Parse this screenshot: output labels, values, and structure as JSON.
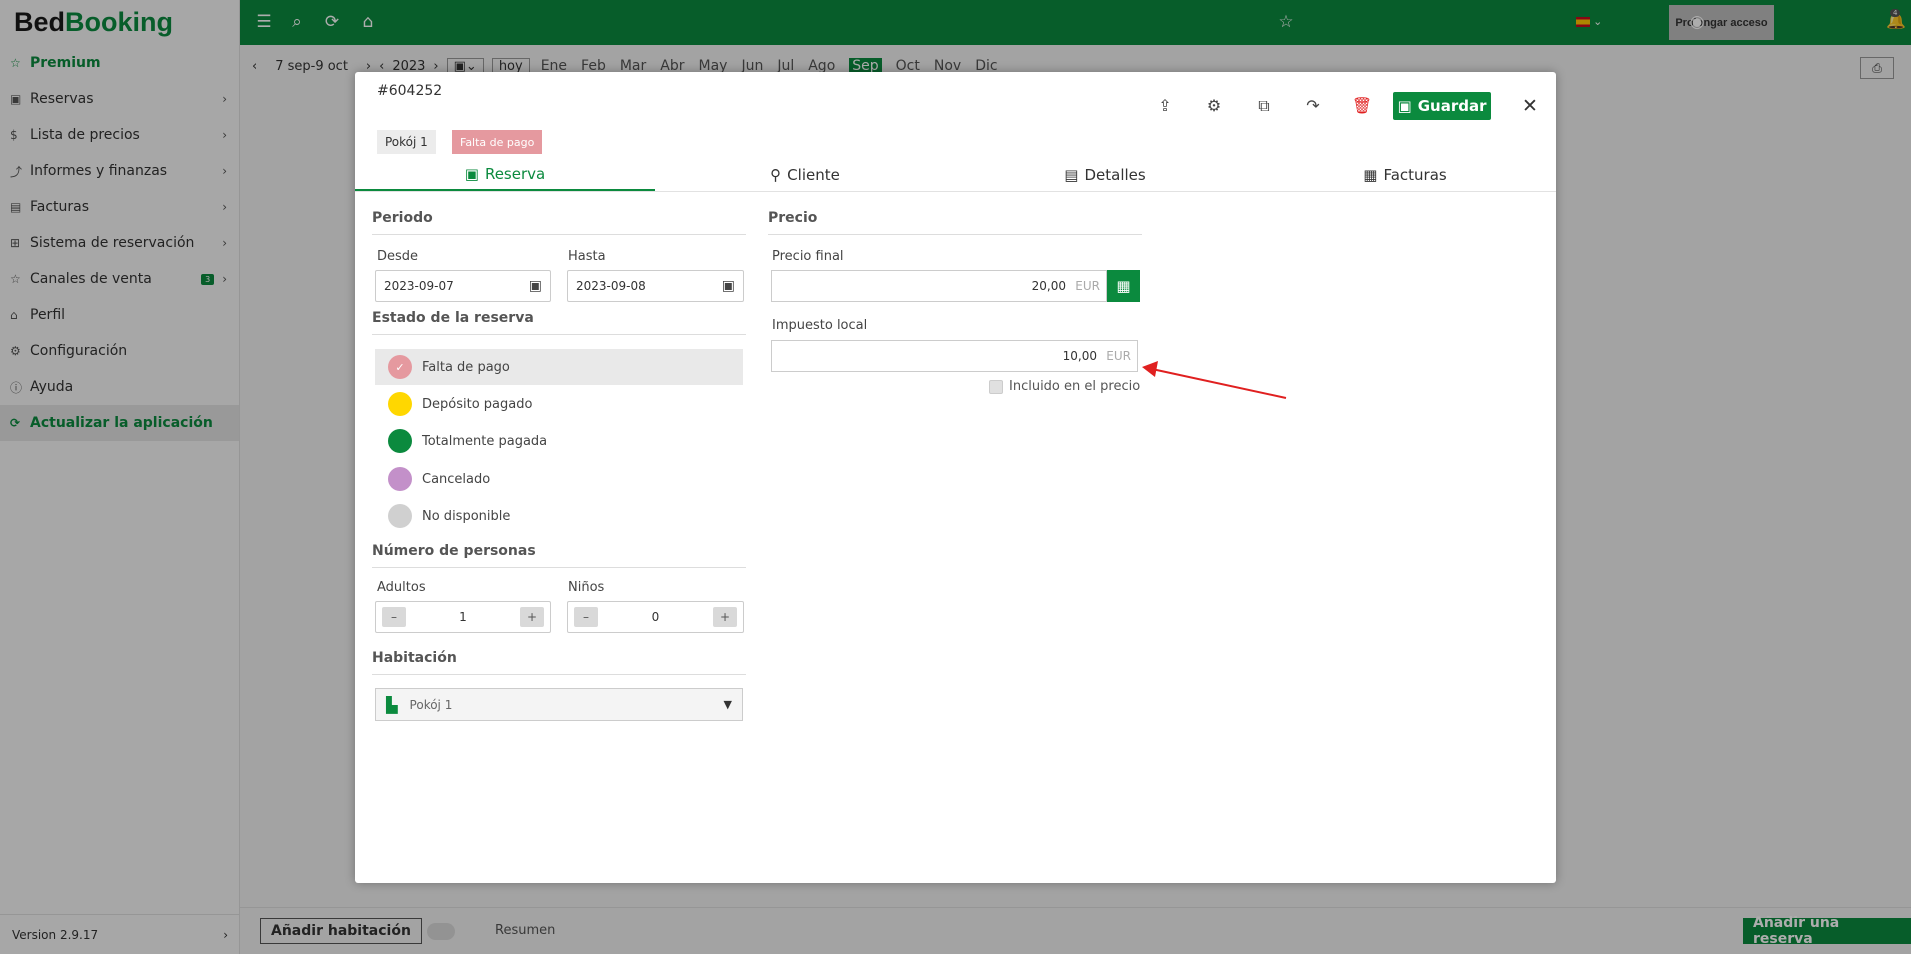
{
  "app": {
    "logo_a": "Bed",
    "logo_b": "Booking"
  },
  "sidebar": {
    "items": [
      {
        "label": "Premium",
        "icon": "star-icon"
      },
      {
        "label": "Reservas",
        "icon": "calendar-icon"
      },
      {
        "label": "Lista de precios",
        "icon": "dollar-icon"
      },
      {
        "label": "Informes y finanzas",
        "icon": "chart-icon"
      },
      {
        "label": "Facturas",
        "icon": "invoice-icon"
      },
      {
        "label": "Sistema de reservación",
        "icon": "grid-icon"
      },
      {
        "label": "Canales de venta",
        "icon": "star-outline-icon",
        "badge": "3"
      },
      {
        "label": "Perfil",
        "icon": "building-icon"
      },
      {
        "label": "Configuración",
        "icon": "gear-icon"
      },
      {
        "label": "Ayuda",
        "icon": "info-icon"
      },
      {
        "label": "Actualizar la aplicación",
        "icon": "refresh-icon"
      }
    ],
    "version": "Version 2.9.17"
  },
  "topbar": {
    "prolong": "Prolongar acceso",
    "notifications": "4"
  },
  "calendar": {
    "range": "7 sep-9 oct",
    "year": "2023",
    "today": "hoy",
    "months": [
      "Ene",
      "Feb",
      "Mar",
      "Abr",
      "May",
      "Jun",
      "Jul",
      "Ago",
      "Sep",
      "Oct",
      "Nov",
      "Dic"
    ],
    "selected_month": "Sep"
  },
  "modal": {
    "id": "#604252",
    "room_tag": "Pokój 1",
    "status_tag": "Falta de pago",
    "save": "Guardar",
    "tabs": [
      "Reserva",
      "Cliente",
      "Detalles",
      "Facturas"
    ],
    "period": {
      "title": "Periodo",
      "from_label": "Desde",
      "from": "2023-09-07",
      "to_label": "Hasta",
      "to": "2023-09-08"
    },
    "status": {
      "title": "Estado de la reserva",
      "options": [
        {
          "label": "Falta de pago",
          "color": "#e5999f"
        },
        {
          "label": "Depósito pagado",
          "color": "#ffd700"
        },
        {
          "label": "Totalmente pagada",
          "color": "#0b8a3e"
        },
        {
          "label": "Cancelado",
          "color": "#c390c9"
        },
        {
          "label": "No disponible",
          "color": "#d0d0d0"
        }
      ],
      "selected": "Falta de pago"
    },
    "persons": {
      "title": "Número de personas",
      "adults_label": "Adultos",
      "adults": "1",
      "children_label": "Niños",
      "children": "0"
    },
    "room": {
      "title": "Habitación",
      "value": "Pokój 1"
    },
    "price": {
      "title": "Precio",
      "final_label": "Precio final",
      "final": "20,00",
      "currency": "EUR",
      "tax_label": "Impuesto local",
      "tax": "10,00",
      "included_label": "Incluido en el precio"
    }
  },
  "bottom": {
    "add_room": "Añadir habitación",
    "summary": "Resumen",
    "add_reservation": "Añadir una reserva"
  }
}
